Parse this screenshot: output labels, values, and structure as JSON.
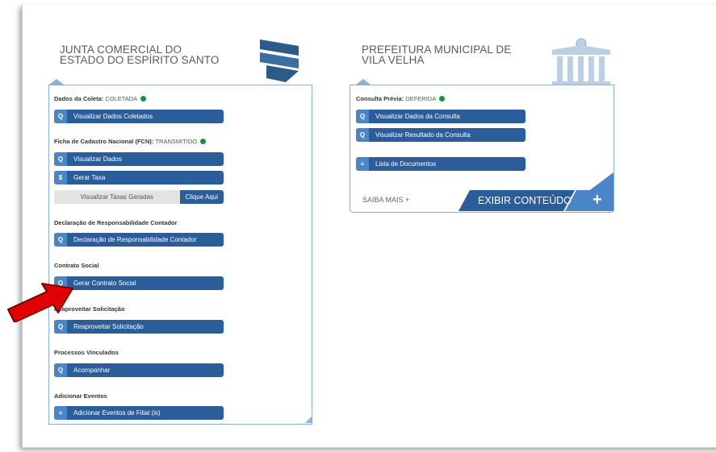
{
  "left": {
    "title_line1": "JUNTA COMERCIAL DO",
    "title_line2": "ESTADO DO ESPÍRITO SANTO",
    "coleta": {
      "label": "Dados da Coleta:",
      "value": "COLETADA"
    },
    "btn_visualizar_coletados": "Visualizar Dados Coletados",
    "fcn": {
      "label": "Ficha de Cadastro Nacional (FCN):",
      "value": "TRANSMITIDO"
    },
    "btn_visualizar_dados": "Visualizar Dados",
    "btn_gerar_taxa": "Gerar Taxa",
    "taxas_text": "Visualizar Taxas Geradas",
    "taxas_link": "Clique Aqui",
    "sec_declaracao": "Declaração de Responsabilidade Contador",
    "btn_declaracao": "Declaração de Responsabilidade Contador",
    "sec_contrato": "Contrato Social",
    "btn_contrato": "Gerar Contrato Social",
    "sec_reaproveitar": "Reaproveitar Solicitação",
    "btn_reaproveitar": "Reaproveitar Solicitação",
    "sec_processos": "Processos Vinculados",
    "btn_acompanhar": "Acompanhar",
    "sec_eventos": "Adicionar Eventos",
    "btn_eventos": "Adicionar Eventos de Filial (is)"
  },
  "right": {
    "title_line1": "PREFEITURA MUNICIPAL DE",
    "title_line2": "VILA VELHA",
    "consulta": {
      "label": "Consulta Prévia:",
      "value": "DEFERIDA"
    },
    "btn_dados_consulta": "Visualizar Dados da Consulta",
    "btn_resultado_consulta": "Visualizar Resultado da Consulta",
    "btn_lista_documentos": "Lista de Documentos",
    "saiba_mais": "SAIBA MAIS +",
    "exibir_conteudo": "EXIBIR CONTEÚDO",
    "plus": "+"
  },
  "icons": {
    "search": "Q",
    "dollar": "$",
    "list": "≡"
  },
  "colors": {
    "button": "#2a5d9a",
    "button_icon": "#4a86c7",
    "status_dot": "#1e8f3d",
    "arrow": "#e00000"
  }
}
